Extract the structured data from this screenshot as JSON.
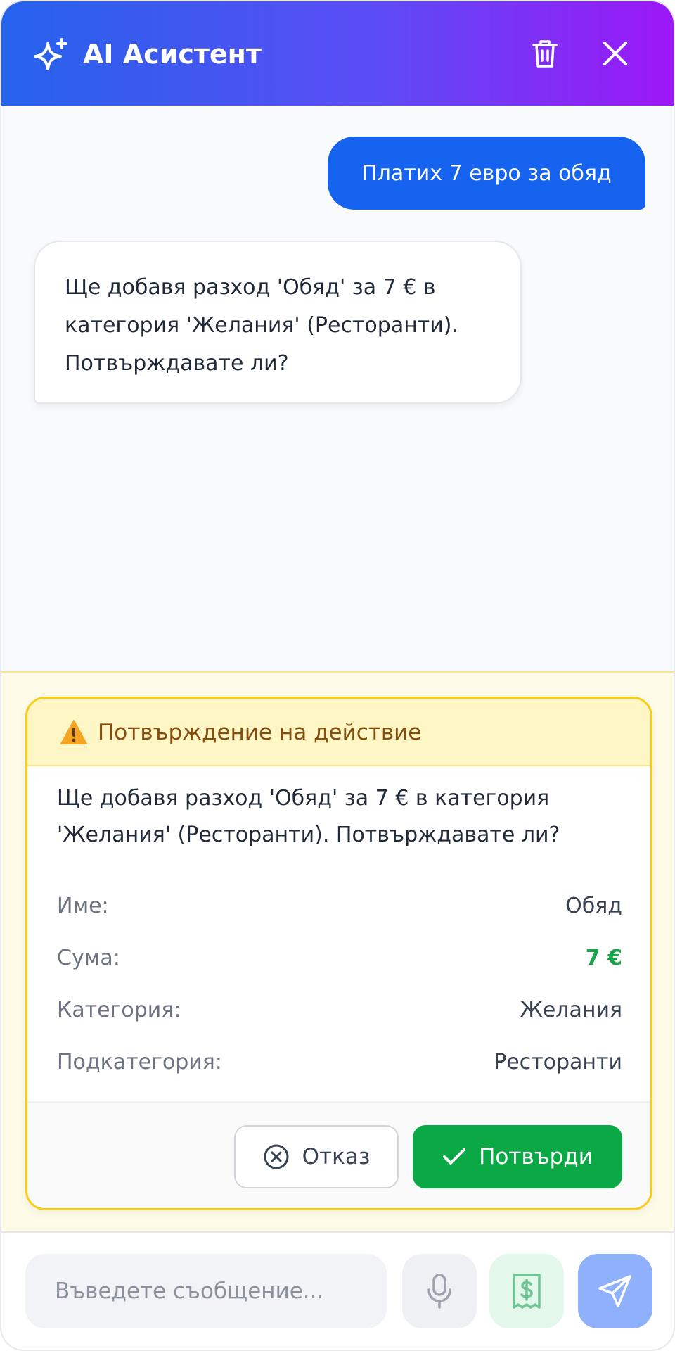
{
  "header": {
    "title": "AI Асистент",
    "icons": {
      "sparkle": "sparkles-icon",
      "trash": "trash-icon",
      "close": "close-icon"
    }
  },
  "chat": {
    "messages": [
      {
        "role": "user",
        "text": "Платих 7 евро за обяд"
      },
      {
        "role": "assistant",
        "text": "Ще добавя разход 'Обяд' за 7 € в категория 'Желания' (Ресторанти). Потвърждавате ли?"
      }
    ]
  },
  "confirmation": {
    "title": "Потвърждение на действие",
    "description": "Ще добавя разход 'Обяд' за 7 € в категория 'Желания' (Ресторанти). Потвърждавате ли?",
    "fields": [
      {
        "label": "Име:",
        "value": "Обяд"
      },
      {
        "label": "Сума:",
        "value": "7 €"
      },
      {
        "label": "Категория:",
        "value": "Желания"
      },
      {
        "label": "Подкатегория:",
        "value": "Ресторанти"
      }
    ],
    "cancel_label": "Отказ",
    "confirm_label": "Потвърди"
  },
  "input": {
    "placeholder": "Въведете съобщение..."
  },
  "colors": {
    "user_bubble": "#1663f0",
    "confirm_button": "#0aa946",
    "amount_green": "#16a34a",
    "warning_border": "#facc15"
  }
}
